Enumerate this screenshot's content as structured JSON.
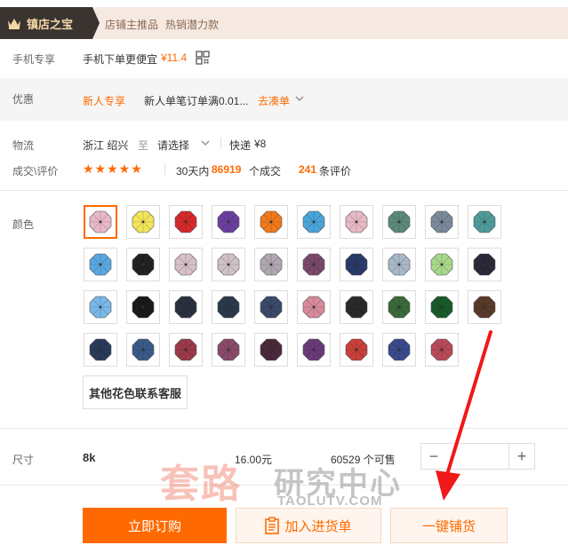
{
  "banner": {
    "badge_label": "镇店之宝",
    "text1": "店铺主推品",
    "text2": "热销潜力款"
  },
  "mobile": {
    "label": "手机专享",
    "text": "手机下单更便宜",
    "price": "¥11.4"
  },
  "promo": {
    "label": "优惠",
    "tag": "新人专享",
    "text": "新人单笔订单满0.01...",
    "link": "去凑单"
  },
  "shipping": {
    "label": "物流",
    "from": "浙江 绍兴",
    "to_word": "至",
    "select": "请选择",
    "method": "快递",
    "price": "¥8"
  },
  "reviews": {
    "label": "成交\\评价",
    "stars": "★★★★★",
    "deals_prefix": "30天内",
    "deals_count": "86919",
    "deals_suffix": "个成交",
    "review_count": "241",
    "review_suffix": "条评价"
  },
  "color": {
    "label": "颜色",
    "swatches": [
      "#e9b8c8",
      "#f3e55a",
      "#d52a2a",
      "#6b3fa0",
      "#f07a1c",
      "#4aa5d8",
      "#e7b9c4",
      "#5a8a7a",
      "#7b8a9a",
      "#4f9b9b",
      "#5aa7e0",
      "#222222",
      "#d8c0c8",
      "#d0c0c8",
      "#b0a8b0",
      "#7a4a6a",
      "#2a3a6a",
      "#a8b8c8",
      "#a7d88a",
      "#2a2a3a",
      "#7ab8e8",
      "#1a1a1a",
      "#2a3040",
      "#2a3a4a",
      "#3a4a6a",
      "#d88a9a",
      "#2a2a2a",
      "#3a6a3a",
      "#1a5a2a",
      "#5a3a2a",
      "#2a3a5a",
      "#3a5a8a",
      "#9a3a4a",
      "#8a4a6a",
      "#4a2a3a",
      "#6a3a7a",
      "#c8403a",
      "#3a4a8a",
      "#b84a5a"
    ],
    "more_button": "其他花色联系客服"
  },
  "size": {
    "label": "尺寸",
    "value": "8k",
    "price": "16.00元",
    "stock": "60529 个可售",
    "minus": "−",
    "plus": "+",
    "quantity": ""
  },
  "actions": {
    "buy": "立即订购",
    "cart": "加入进货单",
    "distribute": "一键铺货"
  },
  "watermark": {
    "cn_red": "套路",
    "cn_gray": "研究中心",
    "url": "TAOLUTV.COM"
  },
  "colors": {
    "accent": "#ff6a00",
    "annotation_arrow": "#f01818"
  }
}
